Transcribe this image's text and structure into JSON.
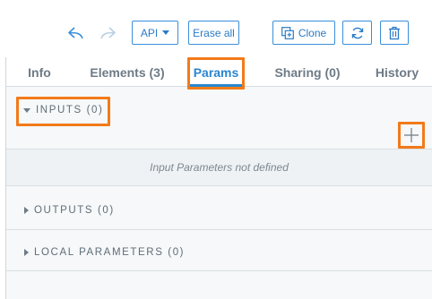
{
  "toolbar": {
    "undo_icon": "undo-icon",
    "redo_icon": "redo-icon",
    "api_label": "API",
    "erase_label": "Erase all",
    "clone_label": "Clone",
    "refresh_icon": "refresh-icon",
    "delete_icon": "trash-icon"
  },
  "tabs": [
    {
      "label": "Info"
    },
    {
      "label": "Elements (3)"
    },
    {
      "label": "Params"
    },
    {
      "label": "Sharing (0)"
    },
    {
      "label": "History"
    }
  ],
  "active_tab": "Params",
  "params": {
    "inputs_label": "INPUTS (0)",
    "add_icon": "plus-icon",
    "empty_message": "Input Parameters not defined",
    "outputs_label": "OUTPUTS (0)",
    "local_label": "LOCAL PARAMETERS (0)"
  },
  "colors": {
    "accent": "#2a86cf",
    "highlight": "#f27a1a",
    "panel_bg": "#f6f8f9"
  }
}
